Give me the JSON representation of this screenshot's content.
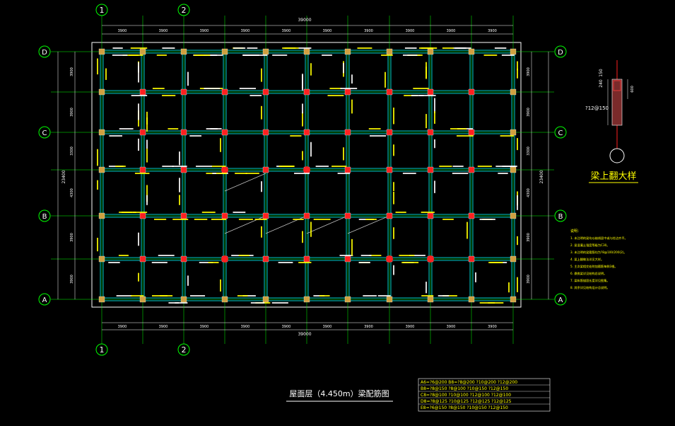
{
  "axes": {
    "cols_top": [
      "1",
      "2"
    ],
    "cols_bottom": [
      "1",
      "2"
    ],
    "rows_left": [
      "D",
      "C",
      "B",
      "A"
    ],
    "rows_right": [
      "D",
      "C",
      "B",
      "A"
    ]
  },
  "dims": {
    "total_width": "39000",
    "bays": [
      "3900",
      "3900",
      "3900",
      "3900",
      "3900",
      "3900",
      "3900",
      "3900",
      "3900",
      "3900"
    ],
    "total_depth": "23400",
    "row_spans_left": [
      "3900",
      "3900",
      "3300",
      "4300",
      "3900",
      "3900"
    ],
    "row_spans_right": [
      "3900",
      "3900",
      "3300",
      "4300",
      "3900",
      "3900"
    ]
  },
  "detail": {
    "title": "梁上翻大样",
    "dim_top": "240",
    "dim_top2": "150",
    "dim_side": "600",
    "rebar": "?12@150"
  },
  "drawing_title": "屋面层（4.450m）梁配筋图",
  "notes_header": "说明：",
  "notes": [
    "1. 未注明的梁均以轴线居中或与柱边齐平。",
    "2. 梁混凝土强度等级为C30。",
    "3. 未注明的梁箍筋均为?8@100/200(2)。",
    "4. 梁上翻做法详见大样。",
    "5. 主次梁相交处附加箍筋每侧3根。",
    "6. 悬挑梁详见结构总说明。",
    "7. 梁纵筋锚固长度详见图集。",
    "8. 其余详见结构设计总说明。"
  ],
  "table_rows": [
    "A6=?6@200  B8=?8@200  ?10@200  ?12@200",
    "B8=?8@150  ?8@100  ?10@150  ?12@150",
    "C8=?8@100  ?10@100  ?12@100  ?12@100",
    "D8=?8@125  ?10@125  ?12@125  ?12@125",
    "E8=?6@150  ?8@150  ?10@150  ?12@150"
  ],
  "colors": {
    "background": "#000000",
    "grid": "#00ff00",
    "beam": "#00c8c8",
    "column": "#ff2020",
    "label": "#ffff00",
    "dimension": "#ffffff",
    "border": "#ffffff"
  }
}
